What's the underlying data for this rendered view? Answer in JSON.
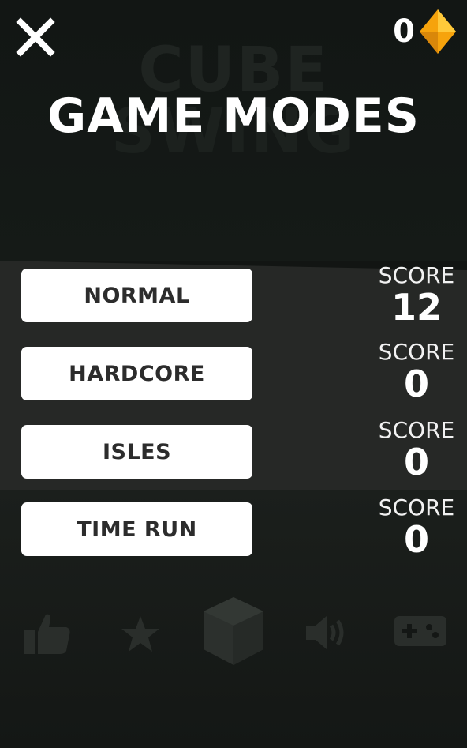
{
  "header": {
    "close_icon": "close-icon",
    "gem_count": "0",
    "gem_icon": "diamond-icon",
    "gem_color": "#f6a30c"
  },
  "background": {
    "ghost_title_line1": "CUBE",
    "ghost_title_line2": "SWING"
  },
  "title": "GAME MODES",
  "modes": [
    {
      "label": "NORMAL",
      "score_label": "SCORE",
      "score": "12"
    },
    {
      "label": "HARDCORE",
      "score_label": "SCORE",
      "score": "0"
    },
    {
      "label": "ISLES",
      "score_label": "SCORE",
      "score": "0"
    },
    {
      "label": "TIME RUN",
      "score_label": "SCORE",
      "score": "0"
    }
  ],
  "bottom_bar": {
    "icons": [
      "thumbs-up-icon",
      "star-icon",
      "cube-icon",
      "speaker-icon",
      "gamepad-icon"
    ],
    "icon_color": "#2a2e2b"
  }
}
